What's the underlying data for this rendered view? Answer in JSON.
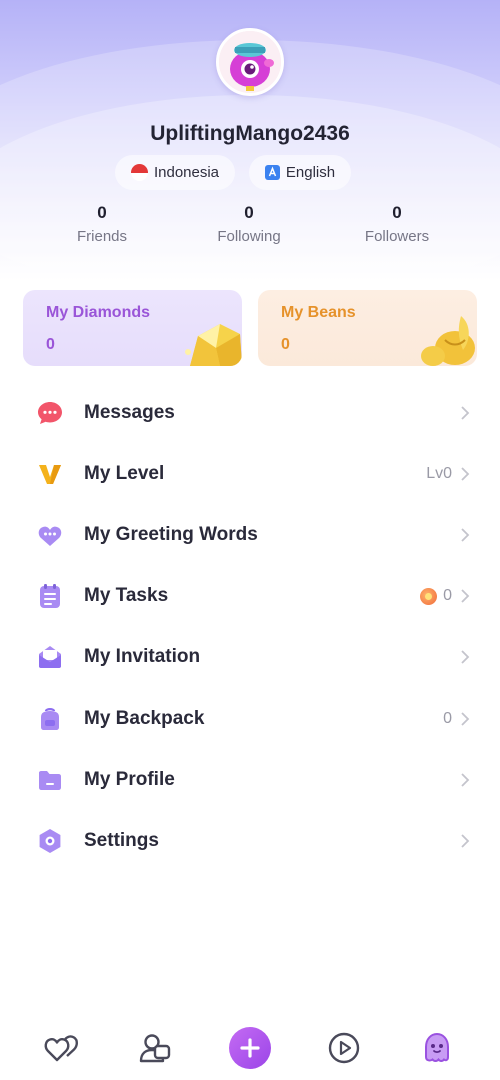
{
  "profile": {
    "username": "UpliftingMango2436",
    "country": "Indonesia",
    "language": "English",
    "stats": [
      {
        "value": "0",
        "label": "Friends"
      },
      {
        "value": "0",
        "label": "Following"
      },
      {
        "value": "0",
        "label": "Followers"
      }
    ]
  },
  "wallet": {
    "diamonds": {
      "title": "My Diamonds",
      "value": "0"
    },
    "beans": {
      "title": "My Beans",
      "value": "0"
    }
  },
  "menu": [
    {
      "label": "Messages",
      "icon": "message-bubble-icon",
      "value": ""
    },
    {
      "label": "My Level",
      "icon": "v-level-icon",
      "value": "Lv0"
    },
    {
      "label": "My Greeting Words",
      "icon": "greeting-heart-icon",
      "value": ""
    },
    {
      "label": "My Tasks",
      "icon": "tasks-notepad-icon",
      "value": "0"
    },
    {
      "label": "My Invitation",
      "icon": "invitation-envelope-icon",
      "value": ""
    },
    {
      "label": "My Backpack",
      "icon": "backpack-icon",
      "value": "0"
    },
    {
      "label": "My Profile",
      "icon": "profile-folder-icon",
      "value": ""
    },
    {
      "label": "Settings",
      "icon": "settings-hexagon-icon",
      "value": ""
    }
  ],
  "colors": {
    "header_top": "#b5b2f7",
    "diamonds_accent": "#9a55d8",
    "beans_accent": "#e6922b",
    "create_button": "#a24ceb"
  },
  "tabbar": [
    {
      "icon": "hearts-icon"
    },
    {
      "icon": "contacts-icon"
    },
    {
      "icon": "plus-icon"
    },
    {
      "icon": "play-icon"
    },
    {
      "icon": "ghost-profile-icon"
    }
  ]
}
